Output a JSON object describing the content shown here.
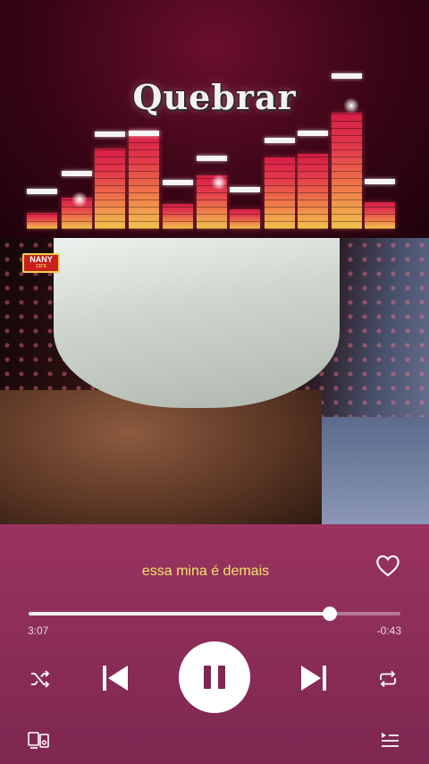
{
  "header": {
    "title": "Quebrar",
    "colors": {
      "background": "#3a0516",
      "bar_top": "#d61d45",
      "bar_bottom": "#f2c24e",
      "cap": "#f4f4f4"
    }
  },
  "video": {
    "watermark_line1": "NANY",
    "watermark_line2": "CD'S"
  },
  "player": {
    "lyric": "essa mina é demais",
    "elapsed": "3:07",
    "remaining": "-0:43",
    "progress_fraction": 0.81,
    "is_playing": true,
    "icons": {
      "like": "heart-outline-icon",
      "shuffle": "shuffle-icon",
      "previous": "skip-previous-icon",
      "play_pause": "pause-icon",
      "next": "skip-next-icon",
      "repeat": "repeat-icon",
      "devices": "connect-device-icon",
      "queue": "queue-icon"
    },
    "colors": {
      "background": "#8b2c57",
      "lyric": "#f1e36a",
      "accent": "#ffffff"
    }
  }
}
